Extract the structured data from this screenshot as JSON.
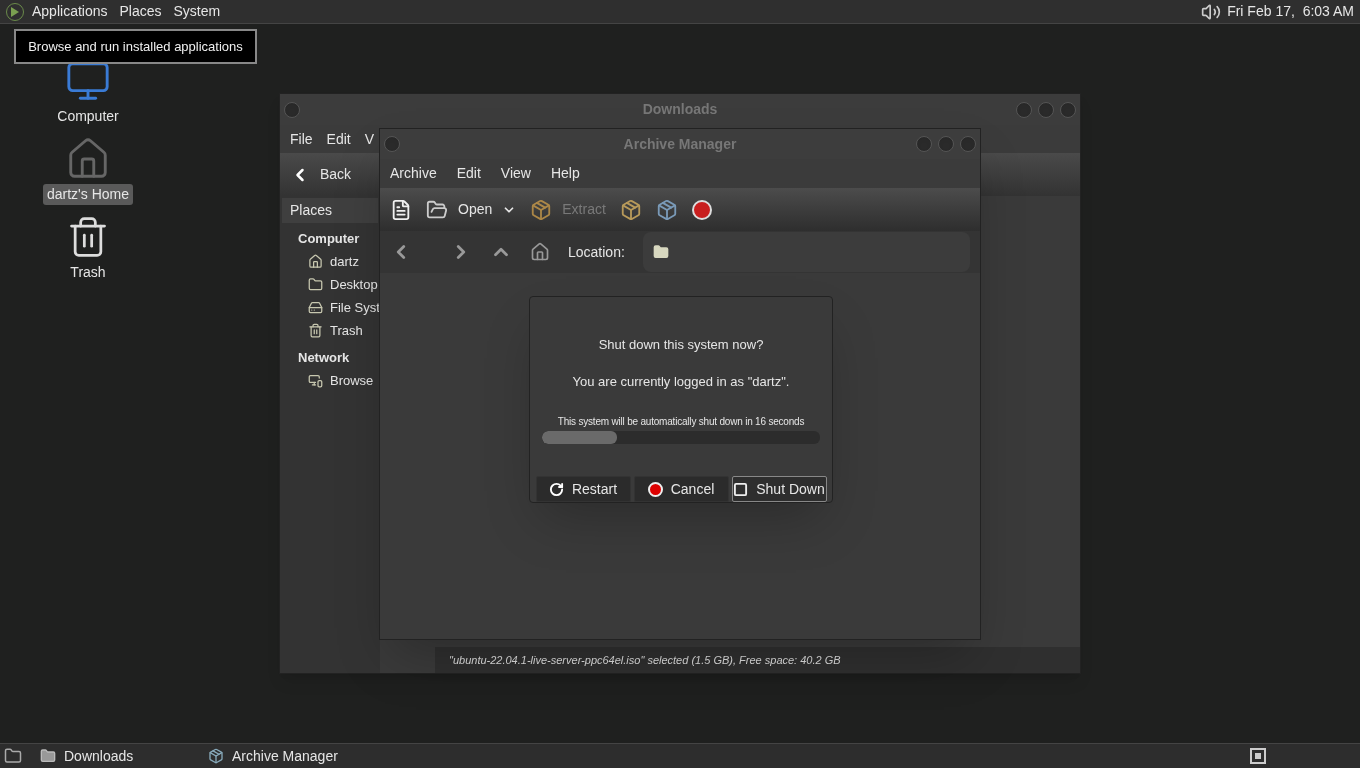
{
  "top_panel": {
    "menus": [
      "Applications",
      "Places",
      "System"
    ],
    "clock": "Fri Feb 17,  6:03 AM"
  },
  "tooltip": "Browse and run installed applications",
  "desktop_icons": [
    {
      "label": "Computer",
      "kind": "computer",
      "selected": false
    },
    {
      "label": "dartz's Home",
      "kind": "home",
      "selected": true
    },
    {
      "label": "Trash",
      "kind": "trash",
      "selected": false
    }
  ],
  "downloads_window": {
    "title": "Downloads",
    "menu": [
      "File",
      "Edit",
      "V"
    ],
    "back_label": "Back",
    "sidebar_header": "Places",
    "sections": [
      {
        "heading": "Computer",
        "items": [
          {
            "label": "dartz",
            "kind": "home"
          },
          {
            "label": "Desktop",
            "kind": "desktop"
          },
          {
            "label": "File Syst",
            "kind": "drive"
          },
          {
            "label": "Trash",
            "kind": "trash"
          }
        ]
      },
      {
        "heading": "Network",
        "items": [
          {
            "label": "Browse",
            "kind": "network"
          }
        ]
      }
    ],
    "status": "\"ubuntu-22.04.1-live-server-ppc64el.iso\" selected (1.5 GB), Free space: 40.2 GB"
  },
  "archive_window": {
    "title": "Archive Manager",
    "menu": [
      "Archive",
      "Edit",
      "View",
      "Help"
    ],
    "toolbar": [
      {
        "kind": "new",
        "disabled": false
      },
      {
        "kind": "open",
        "label": "Open",
        "disabled": false
      },
      {
        "kind": "extract",
        "label": "Extract",
        "disabled": true
      },
      {
        "kind": "add-files",
        "disabled": false
      },
      {
        "kind": "add-folder",
        "disabled": false
      },
      {
        "kind": "stop",
        "disabled": false
      }
    ],
    "location_label": "Location:"
  },
  "dialog": {
    "title": "Shut down this system now?",
    "message": "You are currently logged in as \"dartz\".",
    "countdown": "This system will be automatically shut down in 16 seconds",
    "level": 0.27,
    "buttons": [
      {
        "label": "Restart",
        "kind": "restart",
        "selected": false
      },
      {
        "label": "Cancel",
        "kind": "cancel",
        "selected": false
      },
      {
        "label": "Shut Down",
        "kind": "shutdown",
        "selected": true
      }
    ]
  },
  "taskbar": [
    {
      "label": "Downloads",
      "kind": "folder"
    },
    {
      "label": "Archive Manager",
      "kind": "archive"
    }
  ]
}
